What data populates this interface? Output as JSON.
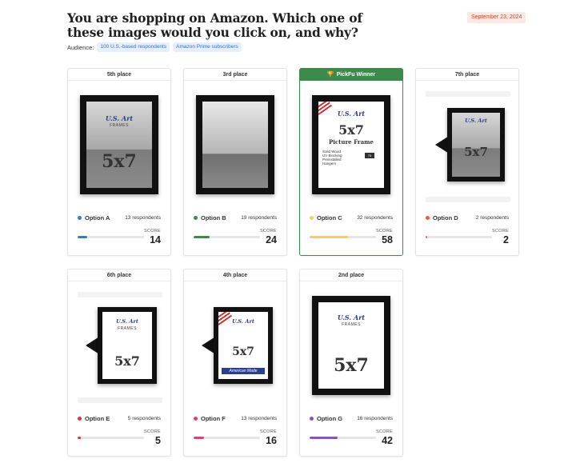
{
  "page": {
    "title": "You are shopping on Amazon. Which one of these images would you click on, and why?",
    "date": "September 23, 2024",
    "audience_label": "Audience:",
    "audience_tags": [
      "100 U.S.-based respondents",
      "Amazon Prime subscribers"
    ],
    "score_label": "SCORE"
  },
  "product_text": {
    "brand": "U.S. Art",
    "frames": "FRAMES",
    "size": "5x7",
    "picture_frame": "Picture Frame",
    "specs": "Solid Wood\nUV Blocking\nPreinstalled\nHangers",
    "badge": "75",
    "american_made": "American Made"
  },
  "cards": [
    {
      "place": "5th place",
      "option": "Option A",
      "respondents": "13 respondents",
      "score": "14",
      "score_value": 14,
      "color": "#3a7abf"
    },
    {
      "place": "3rd place",
      "option": "Option B",
      "respondents": "19 respondents",
      "score": "24",
      "score_value": 24,
      "color": "#3d8a4c"
    },
    {
      "place": "PickFu Winner",
      "option": "Option C",
      "respondents": "32 respondents",
      "score": "58",
      "score_value": 58,
      "color": "#f0d060"
    },
    {
      "place": "7th place",
      "option": "Option D",
      "respondents": "2 respondents",
      "score": "2",
      "score_value": 2,
      "color": "#e2643c"
    },
    {
      "place": "6th place",
      "option": "Option E",
      "respondents": "5 respondents",
      "score": "5",
      "score_value": 5,
      "color": "#d8383e"
    },
    {
      "place": "4th place",
      "option": "Option F",
      "respondents": "13 respondents",
      "score": "16",
      "score_value": 16,
      "color": "#d0457e"
    },
    {
      "place": "2nd place",
      "option": "Option G",
      "respondents": "16 respondents",
      "score": "42",
      "score_value": 42,
      "color": "#8a55b4"
    }
  ]
}
